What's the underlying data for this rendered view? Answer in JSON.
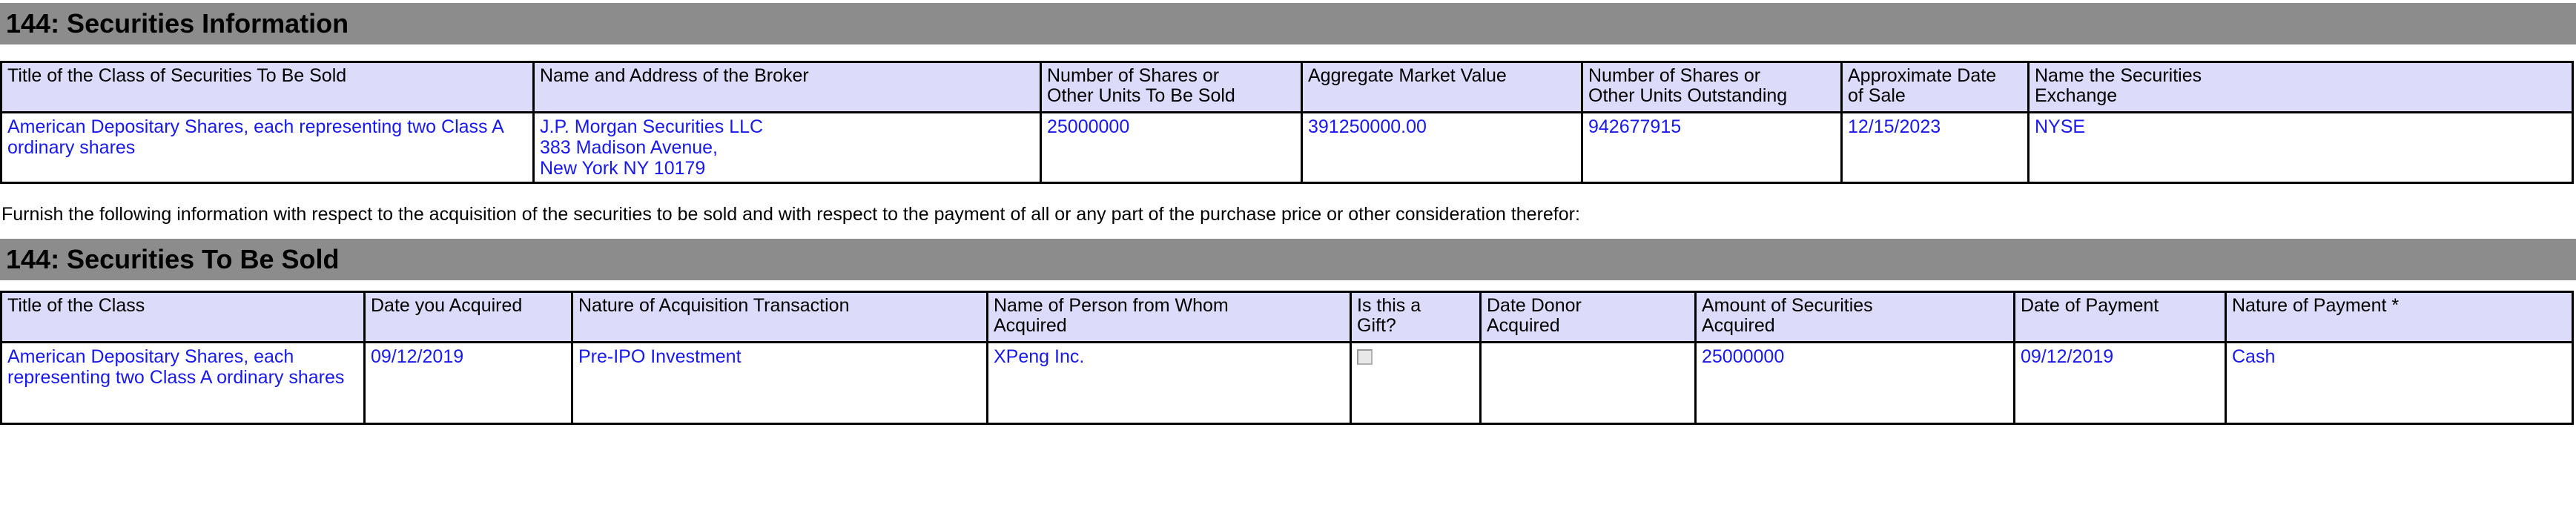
{
  "section_one": {
    "title": "144: Securities Information",
    "columns": [
      "Title of the Class of Securities To Be Sold",
      "Name and Address of the Broker",
      "Number of Shares or Other Units To Be Sold",
      "Aggregate Market Value",
      "Number of Shares or Other Units Outstanding",
      "Approximate Date of Sale",
      "Name the Securities Exchange"
    ],
    "column_lines": [
      [
        "Title of the Class of Securities To Be Sold"
      ],
      [
        "Name and Address of the Broker"
      ],
      [
        "Number of Shares or",
        "Other Units To Be Sold"
      ],
      [
        "Aggregate Market Value"
      ],
      [
        "Number of Shares or",
        "Other Units Outstanding"
      ],
      [
        "Approximate Date",
        "of Sale"
      ],
      [
        "Name the Securities",
        "Exchange"
      ]
    ],
    "row": {
      "title_of_class": "American Depositary Shares, each representing two Class A ordinary shares",
      "broker_line_1": "J.P. Morgan Securities LLC",
      "broker_line_2": "383 Madison Avenue,",
      "broker_line_3": "New York   NY   10179",
      "shares_to_be_sold": "25000000",
      "aggregate_market_value": "391250000.00",
      "units_outstanding": "942677915",
      "approximate_date_of_sale": "12/15/2023",
      "securities_exchange": "NYSE"
    }
  },
  "furnish_note": "Furnish the following information with respect to the acquisition of the securities to be sold and with respect to the payment of all or any part of the purchase price or other consideration therefor:",
  "section_two": {
    "title": "144: Securities To Be Sold",
    "columns": [
      "Title of the Class",
      "Date you Acquired",
      "Nature of Acquisition Transaction",
      "Name of Person from Whom Acquired",
      "Is this a Gift?",
      "Date Donor Acquired",
      "Amount of Securities Acquired",
      "Date of Payment",
      "Nature of Payment *"
    ],
    "column_lines": [
      [
        "Title of the Class"
      ],
      [
        "Date you Acquired"
      ],
      [
        "Nature of Acquisition Transaction"
      ],
      [
        "Name of Person from Whom",
        "Acquired"
      ],
      [
        "Is this a",
        "Gift?"
      ],
      [
        "Date Donor",
        "Acquired"
      ],
      [
        "Amount of Securities",
        "Acquired"
      ],
      [
        "Date of Payment"
      ],
      [
        "Nature of Payment *"
      ]
    ],
    "row": {
      "title_of_class": "American Depositary Shares, each representing two Class A ordinary shares",
      "date_you_acquired": "09/12/2019",
      "nature_of_acquisition": "Pre-IPO Investment",
      "person_from_whom_acquired": "XPeng Inc.",
      "is_this_a_gift": "unchecked",
      "date_donor_acquired": "",
      "amount_of_securities_acquired": "25000000",
      "date_of_payment": "09/12/2019",
      "nature_of_payment": "Cash"
    }
  },
  "colors": {
    "section_bar": "#8c8c8c",
    "header_cell": "#dcdcfa",
    "data_text": "#1818f0",
    "border": "#000000"
  }
}
